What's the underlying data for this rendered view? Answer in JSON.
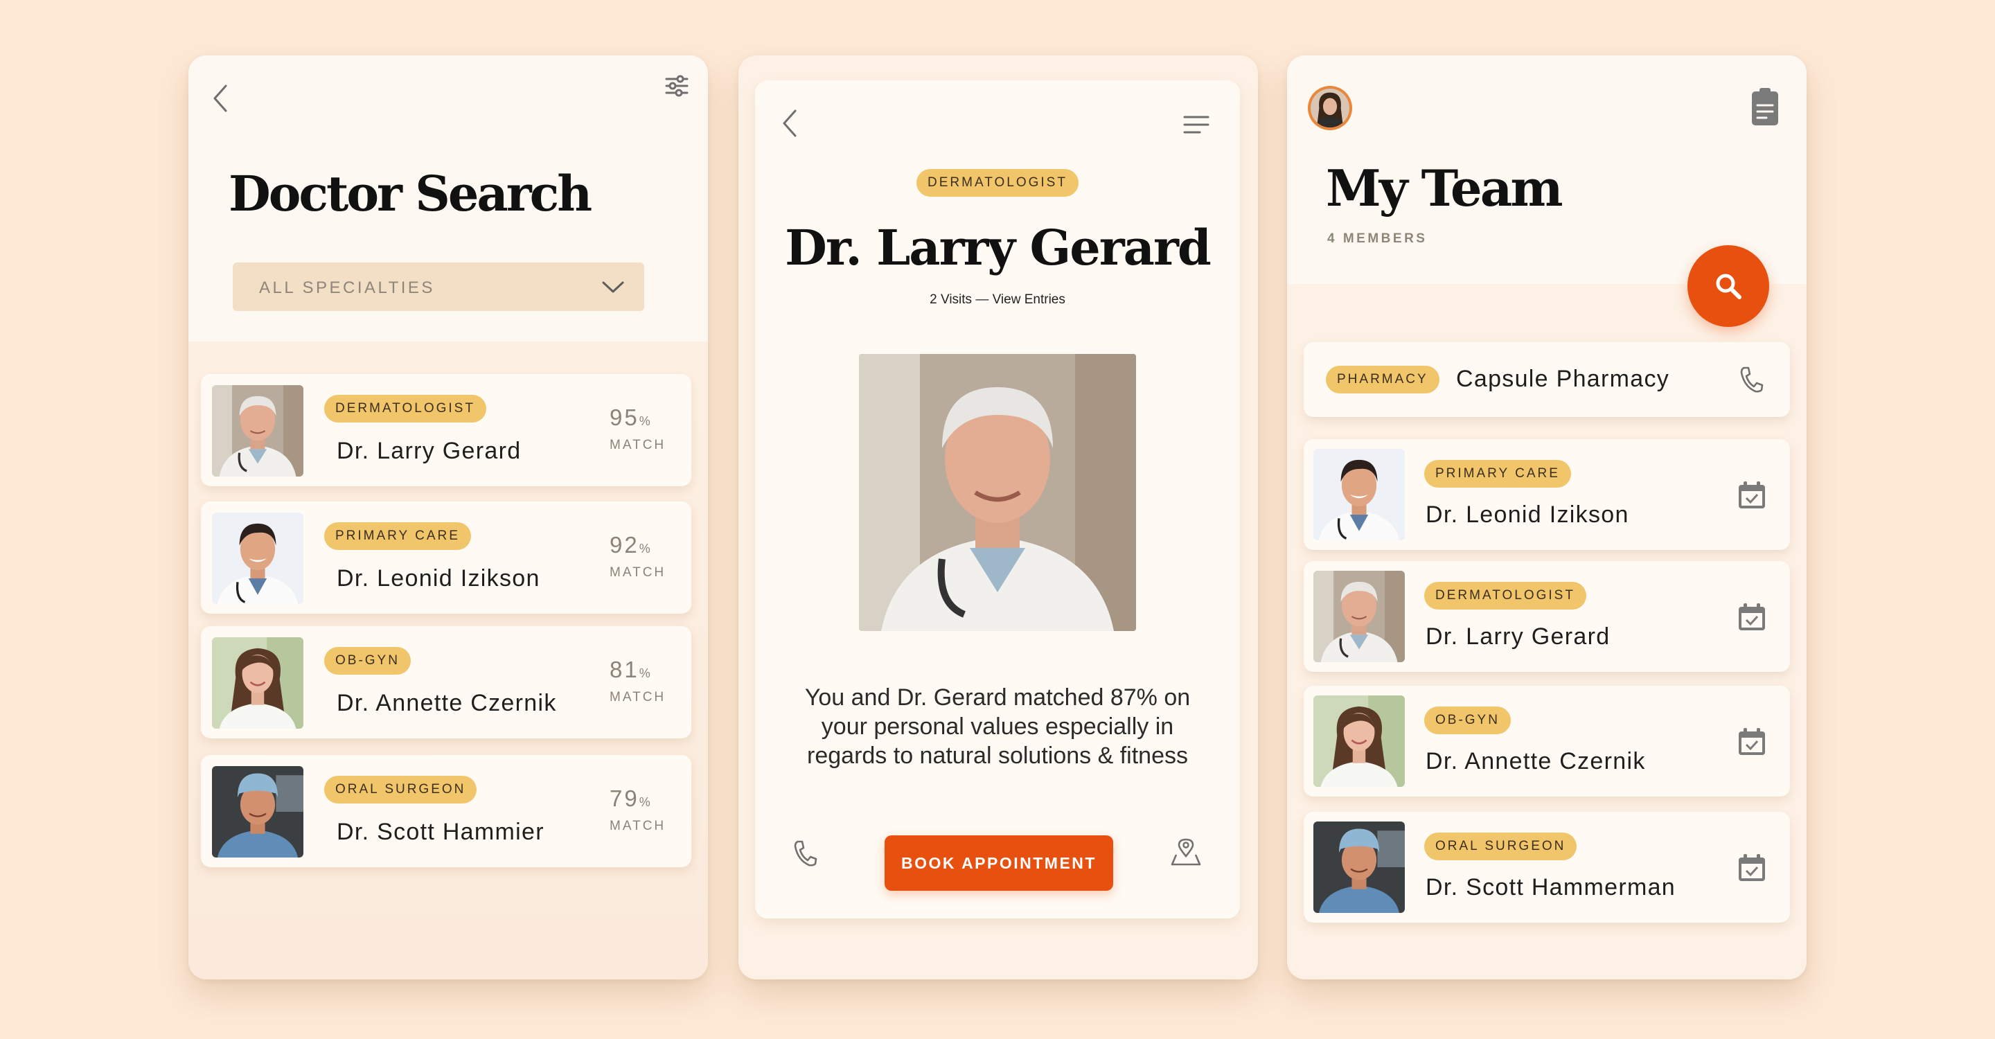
{
  "doctor_search": {
    "title": "Doctor Search",
    "filter_label": "ALL SPECIALTIES",
    "match_label": "MATCH",
    "percent_sign": "%",
    "doctors": [
      {
        "specialty": "DERMATOLOGIST",
        "name": "Dr. Larry Gerard",
        "match": "95"
      },
      {
        "specialty": "PRIMARY CARE",
        "name": "Dr. Leonid Izikson",
        "match": "92"
      },
      {
        "specialty": "OB-GYN",
        "name": "Dr. Annette Czernik",
        "match": "81"
      },
      {
        "specialty": "ORAL SURGEON",
        "name": "Dr. Scott Hammier",
        "match": "79"
      }
    ]
  },
  "doctor_profile": {
    "specialty": "DERMATOLOGIST",
    "name": "Dr. Larry Gerard",
    "visits": "2 Visits",
    "view_entries": "— View Entries",
    "summary": "You and Dr. Gerard matched 87% on your personal values especially in regards to natural solutions & fitness",
    "book_label": "BOOK APPOINTMENT"
  },
  "my_team": {
    "title": "My Team",
    "members_label": "4 MEMBERS",
    "pharmacy": {
      "badge": "PHARMACY",
      "name": "Capsule Pharmacy"
    },
    "members": [
      {
        "specialty": "PRIMARY CARE",
        "name": "Dr. Leonid Izikson"
      },
      {
        "specialty": "DERMATOLOGIST",
        "name": "Dr. Larry Gerard"
      },
      {
        "specialty": "OB-GYN",
        "name": "Dr. Annette Czernik"
      },
      {
        "specialty": "ORAL SURGEON",
        "name": "Dr. Scott Hammerman"
      }
    ]
  },
  "colors": {
    "background": "#fde9d6",
    "accent_orange": "#e8500f",
    "badge_yellow": "#f1c56a",
    "card": "#fffaf3"
  },
  "icons": [
    "back-arrow-icon",
    "filter-sliders-icon",
    "chevron-down-icon",
    "menu-icon",
    "phone-icon",
    "map-pin-icon",
    "clipboard-icon",
    "search-icon",
    "calendar-check-icon"
  ]
}
